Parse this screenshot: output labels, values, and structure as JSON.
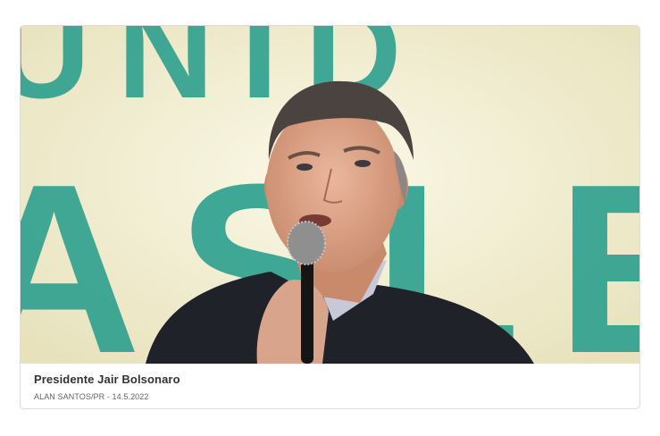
{
  "figure": {
    "caption_title": "Presidente Jair Bolsonaro",
    "caption_credit": "ALAN SANTOS/PR - 14.5.2022",
    "photo_backdrop_letters": [
      "UNID",
      "ASLE"
    ]
  },
  "colors": {
    "backdrop_light": "#f3efcf",
    "backdrop_letters": "#1f9a86",
    "jacket": "#1f2229",
    "card_border": "#dcdcdc",
    "caption_title": "#333333",
    "caption_credit": "#666666"
  }
}
